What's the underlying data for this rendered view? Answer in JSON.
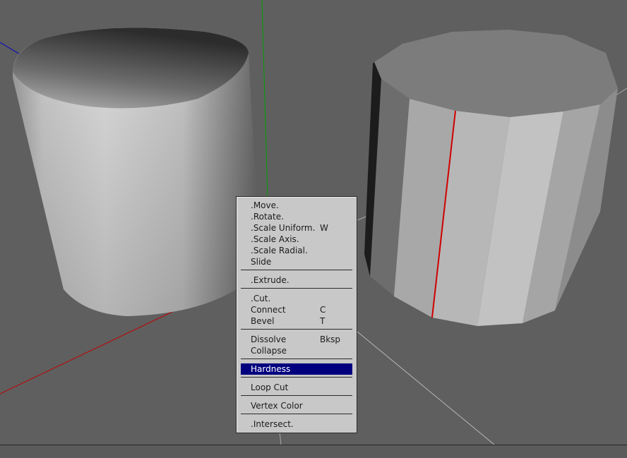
{
  "viewport": {
    "name": "3d-viewport"
  },
  "menu": {
    "groups": [
      [
        {
          "label": ".Move.",
          "shortcut": ""
        },
        {
          "label": ".Rotate.",
          "shortcut": ""
        },
        {
          "label": ".Scale Uniform.",
          "shortcut": "W"
        },
        {
          "label": ".Scale Axis.",
          "shortcut": ""
        },
        {
          "label": ".Scale Radial.",
          "shortcut": ""
        },
        {
          "label": "Slide",
          "shortcut": ""
        }
      ],
      [
        {
          "label": ".Extrude.",
          "shortcut": ""
        }
      ],
      [
        {
          "label": ".Cut.",
          "shortcut": ""
        },
        {
          "label": "Connect",
          "shortcut": "C"
        },
        {
          "label": "Bevel",
          "shortcut": "T"
        }
      ],
      [
        {
          "label": "Dissolve",
          "shortcut": "Bksp"
        },
        {
          "label": "Collapse",
          "shortcut": ""
        }
      ],
      [
        {
          "label": "Hardness",
          "shortcut": "",
          "highlighted": true
        }
      ],
      [
        {
          "label": "Loop Cut",
          "shortcut": ""
        }
      ],
      [
        {
          "label": "Vertex Color",
          "shortcut": ""
        }
      ],
      [
        {
          "label": ".Intersect.",
          "shortcut": ""
        }
      ]
    ]
  },
  "colors": {
    "background": "#5f5f5f",
    "menu_bg": "#c8c8c8",
    "highlight": "#00007e",
    "axis_x": "#c00000",
    "axis_y": "#00a000",
    "axis_z": "#0000c8",
    "selected_edge": "#d00000"
  }
}
